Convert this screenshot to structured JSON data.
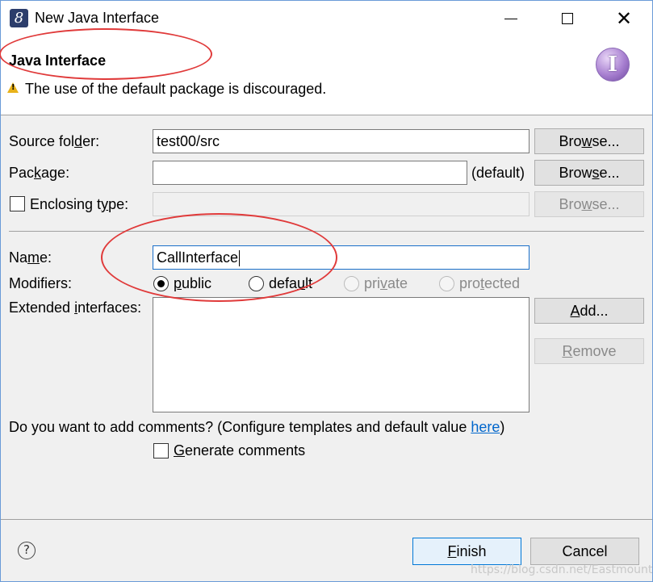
{
  "window": {
    "title": "New Java Interface",
    "icon": "eclipse-icon",
    "controls": {
      "minimize": "minimize-icon",
      "maximize": "maximize-icon",
      "close": "close-icon"
    }
  },
  "banner": {
    "title": "Java Interface",
    "message": "The use of the default package is discouraged.",
    "logo_letter": "I"
  },
  "form": {
    "source_folder": {
      "label_pre": "Source fol",
      "label_mn": "d",
      "label_post": "er:",
      "value": "test00/src"
    },
    "package": {
      "label_pre": "Pac",
      "label_mn": "k",
      "label_post": "age:",
      "value": "",
      "default_label": "(default)"
    },
    "enclosing_type": {
      "label_pre": "Enclosing t",
      "label_mn": "y",
      "label_post": "pe:",
      "value": "",
      "checked": false
    },
    "name": {
      "label_pre": "Na",
      "label_mn": "m",
      "label_post": "e:",
      "value": "CallInterface"
    },
    "modifiers": {
      "label": "Modifiers:",
      "options": [
        {
          "pre": "",
          "mn": "p",
          "post": "ublic"
        },
        {
          "pre": "defa",
          "mn": "u",
          "post": "lt"
        },
        {
          "pre": "pri",
          "mn": "v",
          "post": "ate"
        },
        {
          "pre": "pro",
          "mn": "t",
          "post": "ected"
        }
      ],
      "selected": "public"
    },
    "extended_interfaces": {
      "label_pre": "Extended ",
      "label_mn": "i",
      "label_post": "nterfaces:"
    },
    "comments_question_pre": "Do you want to add comments? (Configure templates and default value ",
    "comments_link": "here",
    "comments_question_post": ")",
    "generate_comments": {
      "pre": "",
      "mn": "G",
      "post": "enerate comments",
      "checked": false
    }
  },
  "buttons": {
    "browse": {
      "pre": "Bro",
      "mn": "w",
      "post": "se..."
    },
    "browse2": {
      "pre": "Brow",
      "mn": "s",
      "post": "e..."
    },
    "browse3": {
      "pre": "Bro",
      "mn": "w",
      "post": "se..."
    },
    "add": {
      "pre": "",
      "mn": "A",
      "post": "dd..."
    },
    "remove": {
      "pre": "",
      "mn": "R",
      "post": "emove"
    },
    "finish": {
      "pre": "",
      "mn": "F",
      "post": "inish"
    },
    "cancel": "Cancel"
  },
  "watermark": "https://blog.csdn.net/Eastmount",
  "colors": {
    "annotation": "#e03a3a",
    "accent": "#0078d7",
    "link": "#0066cc"
  }
}
